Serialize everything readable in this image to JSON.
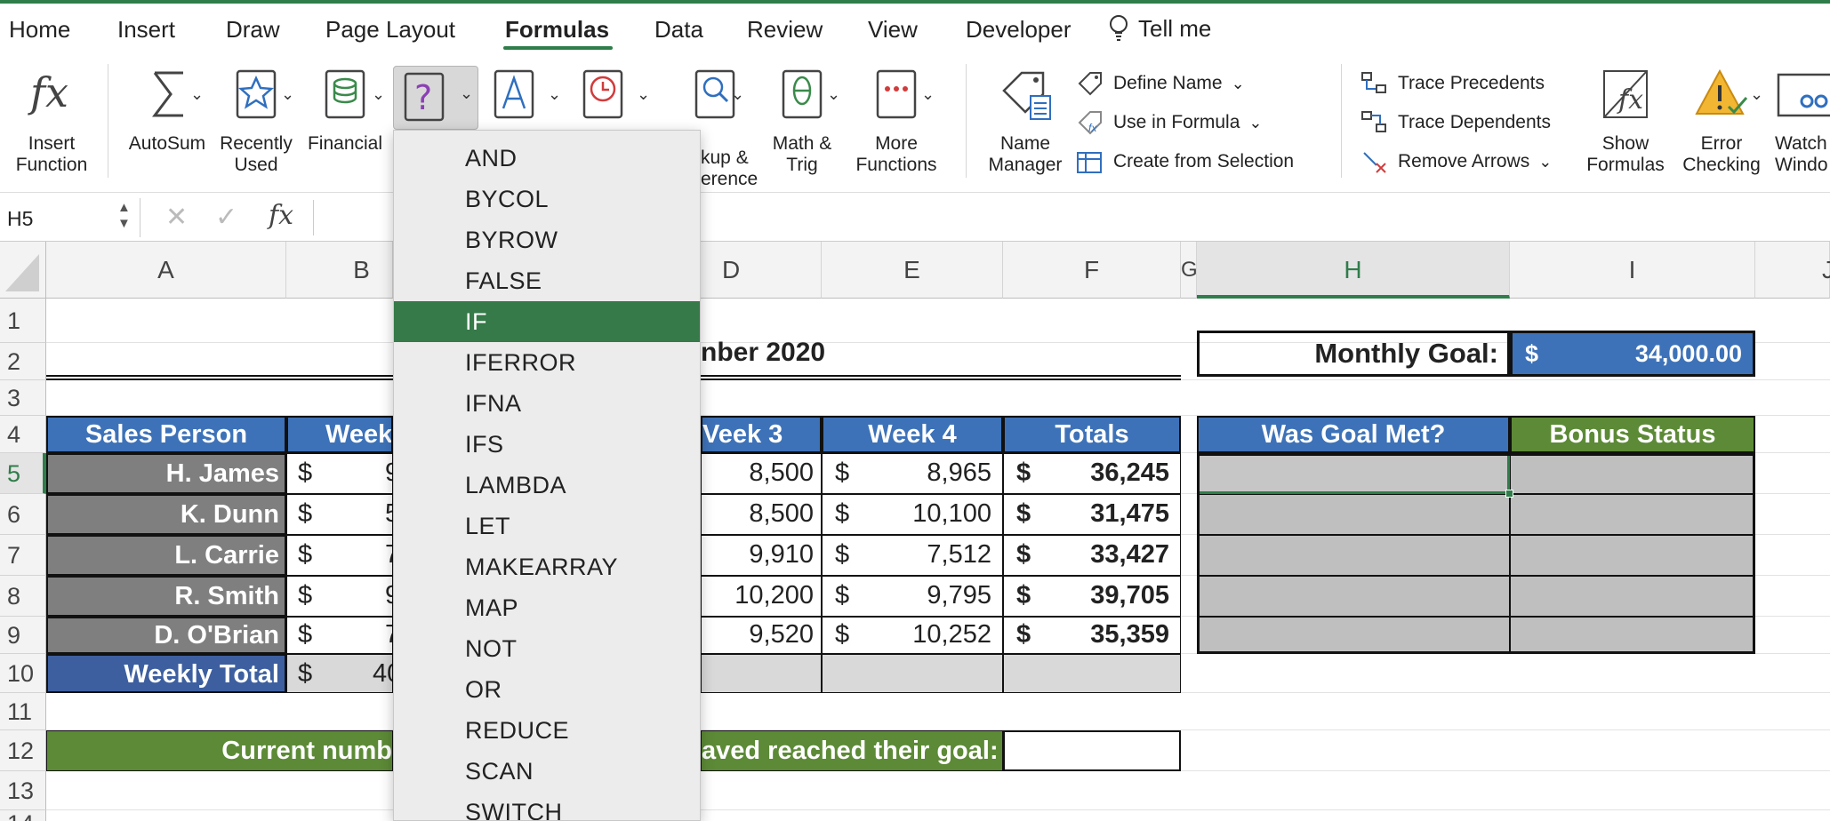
{
  "tabs": [
    "Home",
    "Insert",
    "Draw",
    "Page Layout",
    "Formulas",
    "Data",
    "Review",
    "View",
    "Developer",
    "Tell me"
  ],
  "active_tab": "Formulas",
  "ribbon": {
    "insert_function": [
      "Insert",
      "Function"
    ],
    "autosum": "AutoSum",
    "recently_used": [
      "Recently",
      "Used"
    ],
    "financial": "Financial",
    "lookup_ref": [
      "kup &",
      "erence"
    ],
    "math_trig": [
      "Math &",
      "Trig"
    ],
    "more_functions": [
      "More",
      "Functions"
    ],
    "name_manager": [
      "Name",
      "Manager"
    ],
    "define_name": "Define Name",
    "use_in_formula": "Use in Formula",
    "create_from_selection": "Create from Selection",
    "trace_precedents": "Trace Precedents",
    "trace_dependents": "Trace Dependents",
    "remove_arrows": "Remove Arrows",
    "show_formulas": [
      "Show",
      "Formulas"
    ],
    "error_checking": [
      "Error",
      "Checking"
    ],
    "watch_window": [
      "Watch",
      "Windo"
    ]
  },
  "formula_bar": {
    "name_box": "H5",
    "fx": "fx",
    "value": ""
  },
  "columns": [
    "A",
    "B",
    "D",
    "E",
    "F",
    "G",
    "H",
    "I",
    "J"
  ],
  "rows": [
    "1",
    "2",
    "3",
    "4",
    "5",
    "6",
    "7",
    "8",
    "9",
    "10",
    "11",
    "12",
    "13",
    "14"
  ],
  "sheet": {
    "title_partial": "nber 2020",
    "monthly_goal_label": "Monthly Goal:",
    "monthly_goal_currency": "$",
    "monthly_goal_value": "34,000.00",
    "headers": {
      "sales_person": "Sales Person",
      "week1_partial": "Week",
      "week3_partial": "Veek 3",
      "week4": "Week 4",
      "totals": "Totals",
      "goal_met": "Was Goal Met?",
      "bonus": "Bonus Status"
    },
    "people": [
      {
        "name": "H. James",
        "b": "9",
        "d": "8,500",
        "e": "8,965",
        "total": "36,245"
      },
      {
        "name": "K. Dunn",
        "b": "5",
        "d": "8,500",
        "e": "10,100",
        "total": "31,475"
      },
      {
        "name": "L. Carrie",
        "b": "7",
        "d": "9,910",
        "e": "7,512",
        "total": "33,427"
      },
      {
        "name": "R. Smith",
        "b": "9",
        "d": "10,200",
        "e": "9,795",
        "total": "39,705"
      },
      {
        "name": "D. O'Brian",
        "b": "7",
        "d": "9,520",
        "e": "10,252",
        "total": "35,359"
      }
    ],
    "dollar": "$",
    "weekly_total_label": "Weekly Total",
    "weekly_total_b": "40",
    "current_left": "Current numb",
    "current_right": "aved reached their goal:"
  },
  "dropdown": {
    "items": [
      "AND",
      "BYCOL",
      "BYROW",
      "FALSE",
      "IF",
      "IFERROR",
      "IFNA",
      "IFS",
      "LAMBDA",
      "LET",
      "MAKEARRAY",
      "MAP",
      "NOT",
      "OR",
      "REDUCE",
      "SCAN",
      "SWITCH"
    ],
    "selected": "IF"
  },
  "colors": {
    "accent": "#2f7d4a",
    "header_blue": "#3d72b8",
    "header_green": "#5c8a36",
    "name_grey": "#7f7f7f",
    "empty_grey": "#bfbfbf"
  }
}
